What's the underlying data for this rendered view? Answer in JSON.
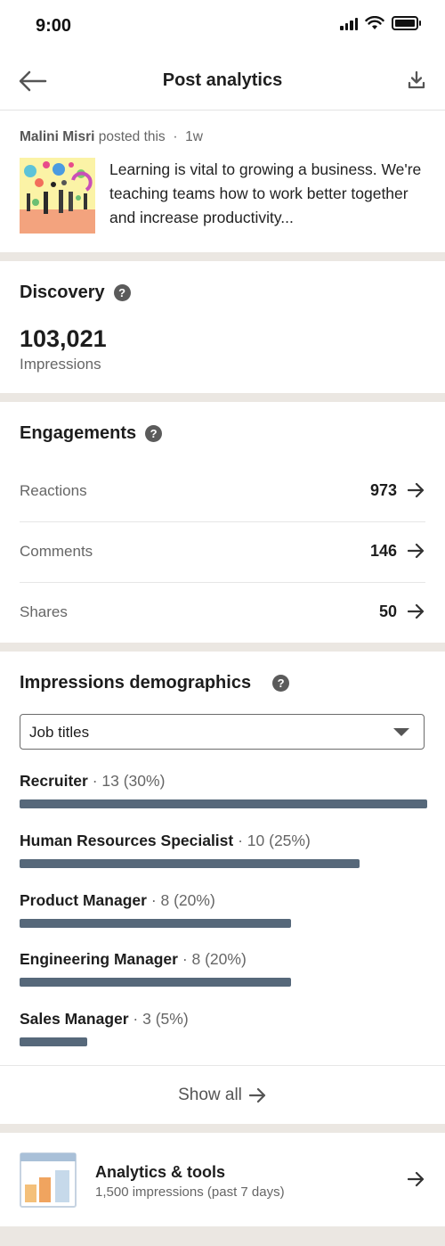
{
  "status_bar": {
    "time": "9:00"
  },
  "header": {
    "title": "Post analytics"
  },
  "post": {
    "author": "Malini Misri",
    "action": "posted this",
    "separator": "·",
    "age": "1w",
    "text": "Learning is vital to growing a business. We're teaching teams how to work better together and increase productivity..."
  },
  "discovery": {
    "title": "Discovery",
    "impressions_value": "103,021",
    "impressions_label": "Impressions"
  },
  "engagements": {
    "title": "Engagements",
    "rows": [
      {
        "label": "Reactions",
        "value": "973"
      },
      {
        "label": "Comments",
        "value": "146"
      },
      {
        "label": "Shares",
        "value": "50"
      }
    ]
  },
  "demographics": {
    "title": "Impressions demographics",
    "selected": "Job titles",
    "rows": [
      {
        "title": "Recruiter",
        "count": " · 13 (30%)",
        "share": 0.3
      },
      {
        "title": "Human Resources Specialist",
        "count": " · 10 (25%)",
        "share": 0.25
      },
      {
        "title": "Product Manager",
        "count": " · 8 (20%)",
        "share": 0.2
      },
      {
        "title": "Engineering Manager",
        "count": " · 8 (20%)",
        "share": 0.2
      },
      {
        "title": "Sales Manager",
        "count": " · 3 (5%)",
        "share": 0.05
      }
    ],
    "show_all": "Show all"
  },
  "analytics": {
    "title": "Analytics & tools",
    "subtitle": "1,500 impressions (past 7 days)"
  },
  "colors": {
    "bar": "#56687a",
    "divider": "#ebe7e2"
  }
}
